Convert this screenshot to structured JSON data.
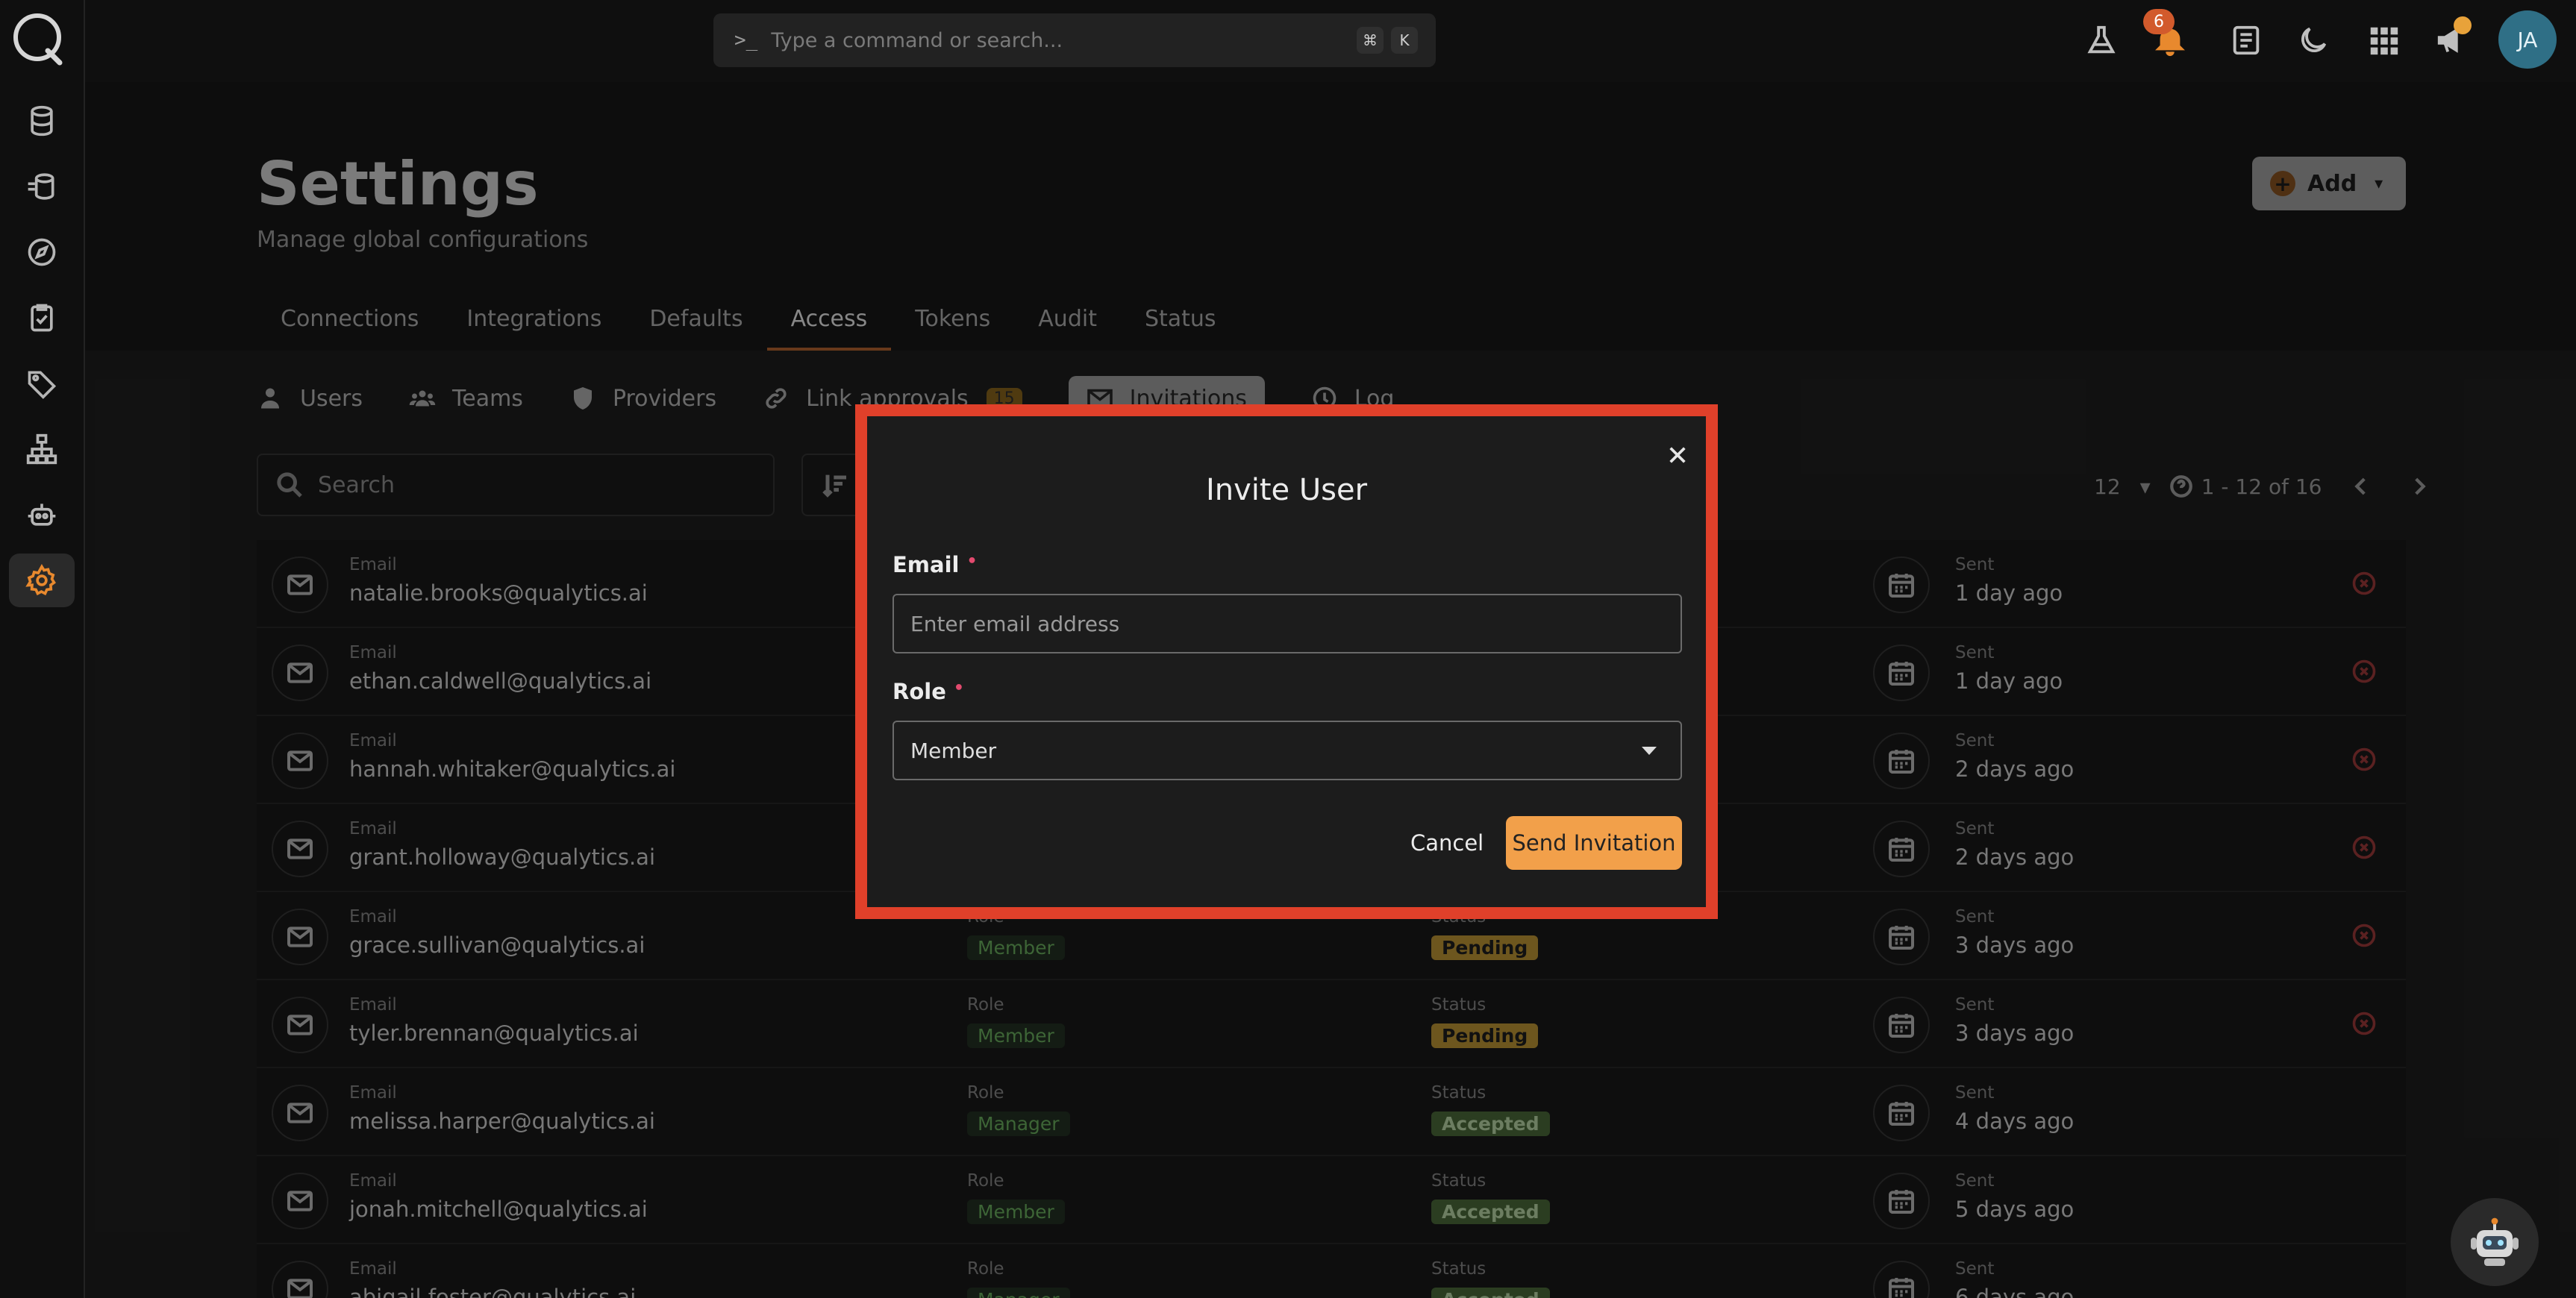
{
  "topbar": {
    "command_placeholder": "Type a command or search...",
    "prompt_glyph": ">_",
    "shortcut_key1": "⌘",
    "shortcut_key2": "K",
    "notification_count": "6",
    "avatar_initials": "JA"
  },
  "header": {
    "title": "Settings",
    "subtitle": "Manage global configurations",
    "add_label": "Add"
  },
  "tabs": [
    {
      "label": "Connections"
    },
    {
      "label": "Integrations"
    },
    {
      "label": "Defaults"
    },
    {
      "label": "Access"
    },
    {
      "label": "Tokens"
    },
    {
      "label": "Audit"
    },
    {
      "label": "Status"
    }
  ],
  "subtabs": [
    {
      "label": "Users"
    },
    {
      "label": "Teams"
    },
    {
      "label": "Providers"
    },
    {
      "label": "Link approvals",
      "count": "15"
    },
    {
      "label": "Invitations"
    },
    {
      "label": "Log"
    }
  ],
  "search": {
    "placeholder": "Search"
  },
  "pager": {
    "per_page": "12",
    "range": "1 - 12 of 16"
  },
  "table": {
    "labels": {
      "email": "Email",
      "role": "Role",
      "status": "Status",
      "sent": "Sent"
    },
    "rows": [
      {
        "email": "natalie.brooks@qualytics.ai",
        "role": "",
        "status": "",
        "sent": "1 day ago",
        "revocable": true
      },
      {
        "email": "ethan.caldwell@qualytics.ai",
        "role": "",
        "status": "",
        "sent": "1 day ago",
        "revocable": true
      },
      {
        "email": "hannah.whitaker@qualytics.ai",
        "role": "",
        "status": "",
        "sent": "2 days ago",
        "revocable": true
      },
      {
        "email": "grant.holloway@qualytics.ai",
        "role": "",
        "status": "",
        "sent": "2 days ago",
        "revocable": true
      },
      {
        "email": "grace.sullivan@qualytics.ai",
        "role": "Member",
        "status": "Pending",
        "sent": "3 days ago",
        "revocable": true
      },
      {
        "email": "tyler.brennan@qualytics.ai",
        "role": "Member",
        "status": "Pending",
        "sent": "3 days ago",
        "revocable": true
      },
      {
        "email": "melissa.harper@qualytics.ai",
        "role": "Manager",
        "status": "Accepted",
        "sent": "4 days ago",
        "revocable": false
      },
      {
        "email": "jonah.mitchell@qualytics.ai",
        "role": "Member",
        "status": "Accepted",
        "sent": "5 days ago",
        "revocable": false
      },
      {
        "email": "abigail.foster@qualytics.ai",
        "role": "Manager",
        "status": "Accepted",
        "sent": "6 days ago",
        "revocable": false
      }
    ]
  },
  "modal": {
    "title": "Invite User",
    "email_label": "Email",
    "email_placeholder": "Enter email address",
    "role_label": "Role",
    "role_value": "Member",
    "required_mark": "•",
    "cancel_label": "Cancel",
    "send_label": "Send Invitation"
  },
  "colors": {
    "accent": "#f2a04a",
    "highlight": "#e0402a",
    "pending": "#a8842f",
    "accepted": "#425e33"
  }
}
